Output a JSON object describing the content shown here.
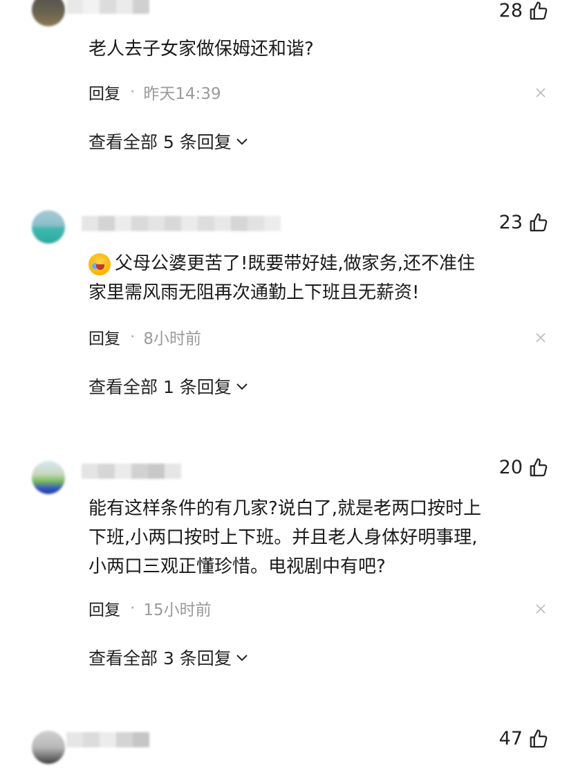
{
  "comments": [
    {
      "likes": "28",
      "text": "老人去子女家做保姆还和谐?",
      "reply_label": "回复",
      "time": "昨天14:39",
      "view_replies": "查看全部 5 条回复"
    },
    {
      "likes": "23",
      "text": "父母公婆更苦了!既要带好娃,做家务,还不准住\n家里需风雨无阻再次通勤上下班且无薪资!",
      "emoji": "crying-laughing-emoji",
      "reply_label": "回复",
      "time": "8小时前",
      "view_replies": "查看全部 1 条回复"
    },
    {
      "likes": "20",
      "text": "能有这样条件的有几家?说白了,就是老两口按时上\n下班,小两口按时上下班。并且老人身体好明事理,\n小两口三观正懂珍惜。电视剧中有吧?",
      "reply_label": "回复",
      "time": "15小时前",
      "view_replies": "查看全部 3 条回复"
    },
    {
      "likes": "47"
    }
  ],
  "icons": {
    "like": "thumbs-up-icon",
    "close": "close-icon",
    "chevron": "chevron-down-icon"
  }
}
